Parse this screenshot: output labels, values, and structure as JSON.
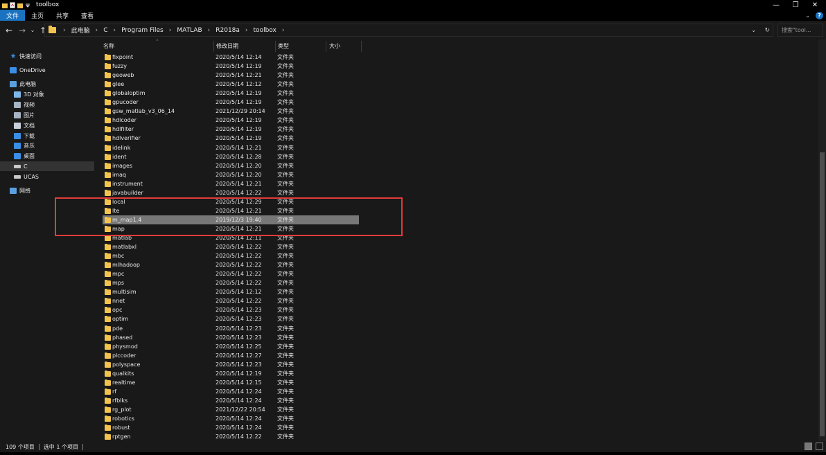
{
  "window": {
    "title": "toolbox",
    "quick_access_icons": [
      "folder-icon",
      "properties-icon",
      "new-folder-icon",
      "customize-qa-icon"
    ],
    "controls": [
      "minimize-icon",
      "restore-icon",
      "close-icon"
    ]
  },
  "ribbon": {
    "tabs": [
      {
        "label": "文件",
        "active": true
      },
      {
        "label": "主页",
        "active": false
      },
      {
        "label": "共享",
        "active": false
      },
      {
        "label": "查看",
        "active": false
      }
    ],
    "help": "?"
  },
  "address": {
    "crumbs": [
      "此电脑",
      "C",
      "Program Files",
      "MATLAB",
      "R2018a",
      "toolbox"
    ],
    "search_placeholder": "搜索\"tool..."
  },
  "nav_pane": {
    "items": [
      {
        "label": "快速访问",
        "icon": "star-icon",
        "indent": 0
      },
      {
        "label": "OneDrive",
        "icon": "cloud-icon",
        "indent": 0
      },
      {
        "label": "此电脑",
        "icon": "pc-icon",
        "indent": 0
      },
      {
        "label": "3D 对象",
        "icon": "cube-icon",
        "indent": 1
      },
      {
        "label": "视频",
        "icon": "video-icon",
        "indent": 1
      },
      {
        "label": "图片",
        "icon": "picture-icon",
        "indent": 1
      },
      {
        "label": "文档",
        "icon": "document-icon",
        "indent": 1
      },
      {
        "label": "下载",
        "icon": "download-icon",
        "indent": 1
      },
      {
        "label": "音乐",
        "icon": "music-icon",
        "indent": 1
      },
      {
        "label": "桌面",
        "icon": "desktop-icon",
        "indent": 1
      },
      {
        "label": "C",
        "icon": "drive-icon",
        "indent": 1,
        "selected": true
      },
      {
        "label": "UCAS",
        "icon": "drive-icon",
        "indent": 1
      },
      {
        "label": "网络",
        "icon": "network-icon",
        "indent": 0
      }
    ]
  },
  "columns": [
    "名称",
    "修改日期",
    "类型",
    "大小"
  ],
  "files": [
    {
      "name": "fixpoint",
      "date": "2020/5/14 12:14",
      "type": "文件夹"
    },
    {
      "name": "fuzzy",
      "date": "2020/5/14 12:19",
      "type": "文件夹"
    },
    {
      "name": "geoweb",
      "date": "2020/5/14 12:21",
      "type": "文件夹"
    },
    {
      "name": "glee",
      "date": "2020/5/14 12:12",
      "type": "文件夹"
    },
    {
      "name": "globaloptim",
      "date": "2020/5/14 12:19",
      "type": "文件夹"
    },
    {
      "name": "gpucoder",
      "date": "2020/5/14 12:19",
      "type": "文件夹"
    },
    {
      "name": "gsw_matlab_v3_06_14",
      "date": "2021/12/29 20:14",
      "type": "文件夹"
    },
    {
      "name": "hdlcoder",
      "date": "2020/5/14 12:19",
      "type": "文件夹"
    },
    {
      "name": "hdlfilter",
      "date": "2020/5/14 12:19",
      "type": "文件夹"
    },
    {
      "name": "hdlverifier",
      "date": "2020/5/14 12:19",
      "type": "文件夹"
    },
    {
      "name": "idelink",
      "date": "2020/5/14 12:21",
      "type": "文件夹"
    },
    {
      "name": "ident",
      "date": "2020/5/14 12:28",
      "type": "文件夹"
    },
    {
      "name": "images",
      "date": "2020/5/14 12:20",
      "type": "文件夹"
    },
    {
      "name": "imaq",
      "date": "2020/5/14 12:20",
      "type": "文件夹"
    },
    {
      "name": "instrument",
      "date": "2020/5/14 12:21",
      "type": "文件夹"
    },
    {
      "name": "javabuilder",
      "date": "2020/5/14 12:22",
      "type": "文件夹"
    },
    {
      "name": "local",
      "date": "2020/5/14 12:29",
      "type": "文件夹"
    },
    {
      "name": "lte",
      "date": "2020/5/14 12:21",
      "type": "文件夹"
    },
    {
      "name": "m_map1.4",
      "date": "2019/12/3 19:40",
      "type": "文件夹",
      "selected": true
    },
    {
      "name": "map",
      "date": "2020/5/14 12:21",
      "type": "文件夹"
    },
    {
      "name": "matlab",
      "date": "2020/5/14 12:11",
      "type": "文件夹"
    },
    {
      "name": "matlabxl",
      "date": "2020/5/14 12:22",
      "type": "文件夹"
    },
    {
      "name": "mbc",
      "date": "2020/5/14 12:22",
      "type": "文件夹"
    },
    {
      "name": "mlhadoop",
      "date": "2020/5/14 12:22",
      "type": "文件夹"
    },
    {
      "name": "mpc",
      "date": "2020/5/14 12:22",
      "type": "文件夹"
    },
    {
      "name": "mps",
      "date": "2020/5/14 12:22",
      "type": "文件夹"
    },
    {
      "name": "multisim",
      "date": "2020/5/14 12:12",
      "type": "文件夹"
    },
    {
      "name": "nnet",
      "date": "2020/5/14 12:22",
      "type": "文件夹"
    },
    {
      "name": "opc",
      "date": "2020/5/14 12:23",
      "type": "文件夹"
    },
    {
      "name": "optim",
      "date": "2020/5/14 12:23",
      "type": "文件夹"
    },
    {
      "name": "pde",
      "date": "2020/5/14 12:23",
      "type": "文件夹"
    },
    {
      "name": "phased",
      "date": "2020/5/14 12:23",
      "type": "文件夹"
    },
    {
      "name": "physmod",
      "date": "2020/5/14 12:25",
      "type": "文件夹"
    },
    {
      "name": "plccoder",
      "date": "2020/5/14 12:27",
      "type": "文件夹"
    },
    {
      "name": "polyspace",
      "date": "2020/5/14 12:23",
      "type": "文件夹"
    },
    {
      "name": "qualkits",
      "date": "2020/5/14 12:19",
      "type": "文件夹"
    },
    {
      "name": "realtime",
      "date": "2020/5/14 12:15",
      "type": "文件夹"
    },
    {
      "name": "rf",
      "date": "2020/5/14 12:24",
      "type": "文件夹"
    },
    {
      "name": "rfblks",
      "date": "2020/5/14 12:24",
      "type": "文件夹"
    },
    {
      "name": "rg_plot",
      "date": "2021/12/22 20:54",
      "type": "文件夹"
    },
    {
      "name": "robotics",
      "date": "2020/5/14 12:24",
      "type": "文件夹"
    },
    {
      "name": "robust",
      "date": "2020/5/14 12:24",
      "type": "文件夹"
    },
    {
      "name": "rptgen",
      "date": "2020/5/14 12:22",
      "type": "文件夹"
    }
  ],
  "status": {
    "item_count": "109 个项目",
    "selected": "选中 1 个项目"
  },
  "colors": {
    "folder": "#f2c44e",
    "accent": "#1a73c0",
    "selection": "#777777",
    "annotation": "#e23b3b"
  }
}
